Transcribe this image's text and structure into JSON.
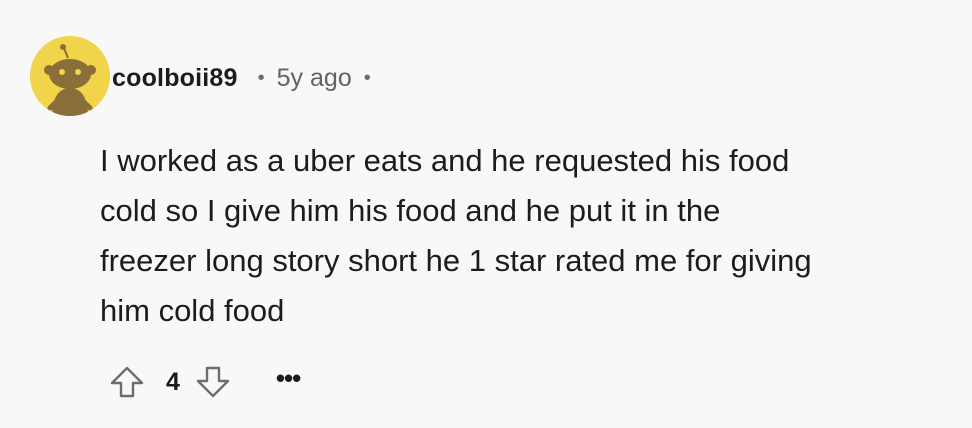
{
  "comment": {
    "avatar": {
      "icon": "reddit-snoo-avatar-icon",
      "background": "#f2d44a",
      "figure_color": "#8a6f3a"
    },
    "username": "coolboii89",
    "separator": "•",
    "timestamp": "5y ago",
    "body_lines": [
      "I worked as a uber eats and he requested his food",
      "cold so I give him his food and he put it in the",
      "freezer long story short he 1 star rated me for giving",
      "him cold food"
    ],
    "actions": {
      "upvote_icon": "upvote-arrow-icon",
      "score": "4",
      "downvote_icon": "downvote-arrow-icon",
      "more_label": "•••"
    }
  }
}
